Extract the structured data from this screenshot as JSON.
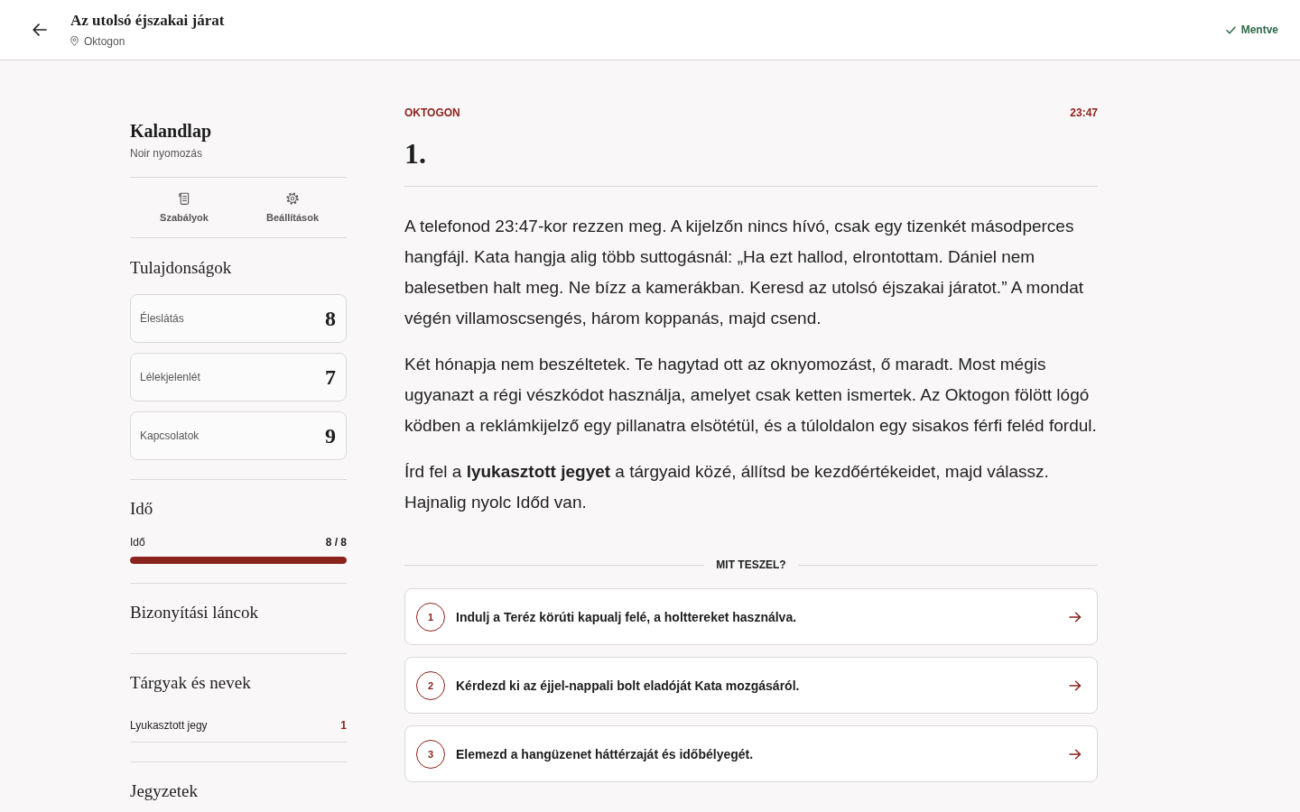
{
  "header": {
    "title": "Az utolsó éjszakai járat",
    "location": "Oktogon",
    "save_status": "Mentve"
  },
  "sidebar": {
    "title": "Kalandlap",
    "subtitle": "Noir nyomozás",
    "tools": [
      {
        "kind": "rules",
        "label": "Szabályok"
      },
      {
        "kind": "settings",
        "label": "Beállítások"
      }
    ],
    "sections": [
      {
        "kind": "stats",
        "heading": "Tulajdonságok",
        "stats": [
          {
            "label": "Éleslátás",
            "value": "8"
          },
          {
            "label": "Lélekjelenlét",
            "value": "7"
          },
          {
            "label": "Kapcsolatok",
            "value": "9"
          }
        ]
      },
      {
        "kind": "meters",
        "heading": "Idő",
        "meters": [
          {
            "label": "Idő",
            "reading": "8 / 8",
            "level": 1
          }
        ]
      },
      {
        "kind": "list",
        "heading": "Bizonyítási láncok"
      },
      {
        "kind": "list",
        "heading": "Tárgyak és nevek",
        "items": [
          {
            "name": "Lyukasztott jegy",
            "count": "1"
          }
        ]
      },
      {
        "kind": "list",
        "heading": "Jegyzetek"
      }
    ]
  },
  "scene": {
    "location": "OKTOGON",
    "time": "23:47",
    "number": "1.",
    "paragraphs": [
      "A telefonod 23:47-kor rezzen meg. A kijelzőn nincs hívó, csak egy tizenkét másodperces hangfájl. Kata hangja alig több suttogásnál: „Ha ezt hallod, elrontottam. Dániel nem balesetben halt meg. Ne bízz a kamerákban. Keresd az utolsó éjszakai járatot.” A mondat végén villamoscsengés, három koppanás, majd csend.",
      "Két hónapja nem beszéltetek. Te hagytad ott az oknyomozást, ő maradt. Most mégis ugyanazt a régi vészkódot használja, amelyet csak ketten ismertek. Az Oktogon fölött lógó ködben a reklámkijelző egy pillanatra elsötétül, és a túloldalon egy sisakos férfi feléd fordul.",
      "Írd fel a **lyukasztott jegyet** a tárgyaid közé, állítsd be kezdőértékeidet, majd válassz. Hajnalig nyolc Időd van."
    ],
    "choices_heading": "MIT TESZEL?",
    "choices": [
      {
        "number": "1",
        "text": "Indulj a Teréz körúti kapualj felé, a holttereket használva."
      },
      {
        "number": "2",
        "text": "Kérdezd ki az éjjel-nappali bolt eladóját Kata mozgásáról."
      },
      {
        "number": "3",
        "text": "Elemezd a hangüzenet háttérzaját és időbélyegét."
      }
    ]
  }
}
